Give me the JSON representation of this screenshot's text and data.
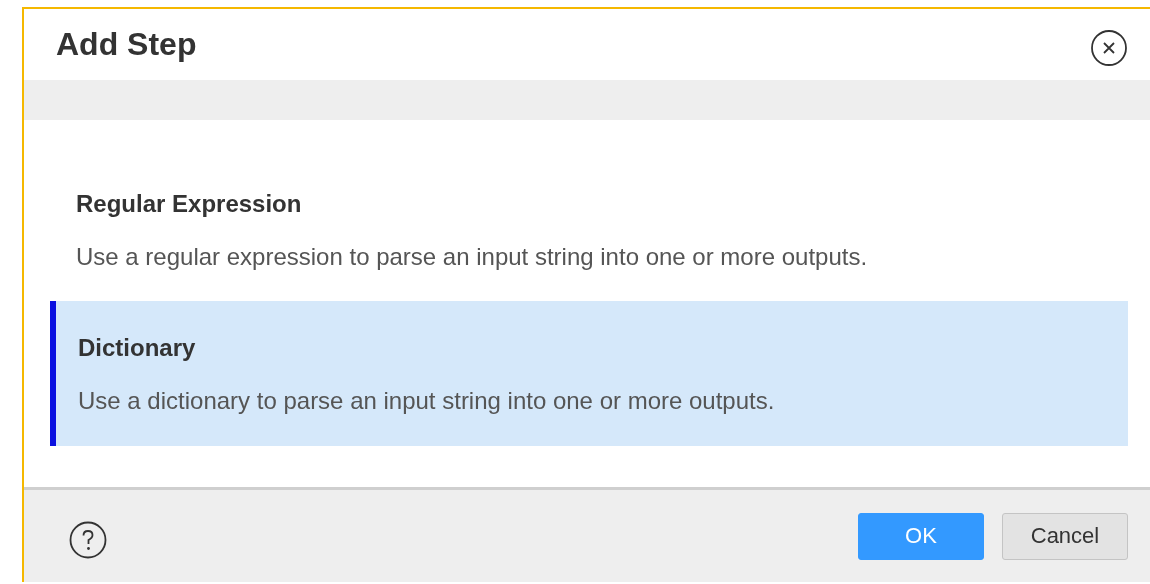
{
  "dialog": {
    "title": "Add Step"
  },
  "options": [
    {
      "title": "Regular Expression",
      "description": "Use a regular expression to parse an input string into one or more outputs.",
      "selected": false
    },
    {
      "title": "Dictionary",
      "description": "Use a dictionary to parse an input string into one or more outputs.",
      "selected": true
    }
  ],
  "buttons": [
    {
      "label": "OK",
      "kind": "primary"
    },
    {
      "label": "Cancel",
      "kind": "secondary"
    }
  ]
}
